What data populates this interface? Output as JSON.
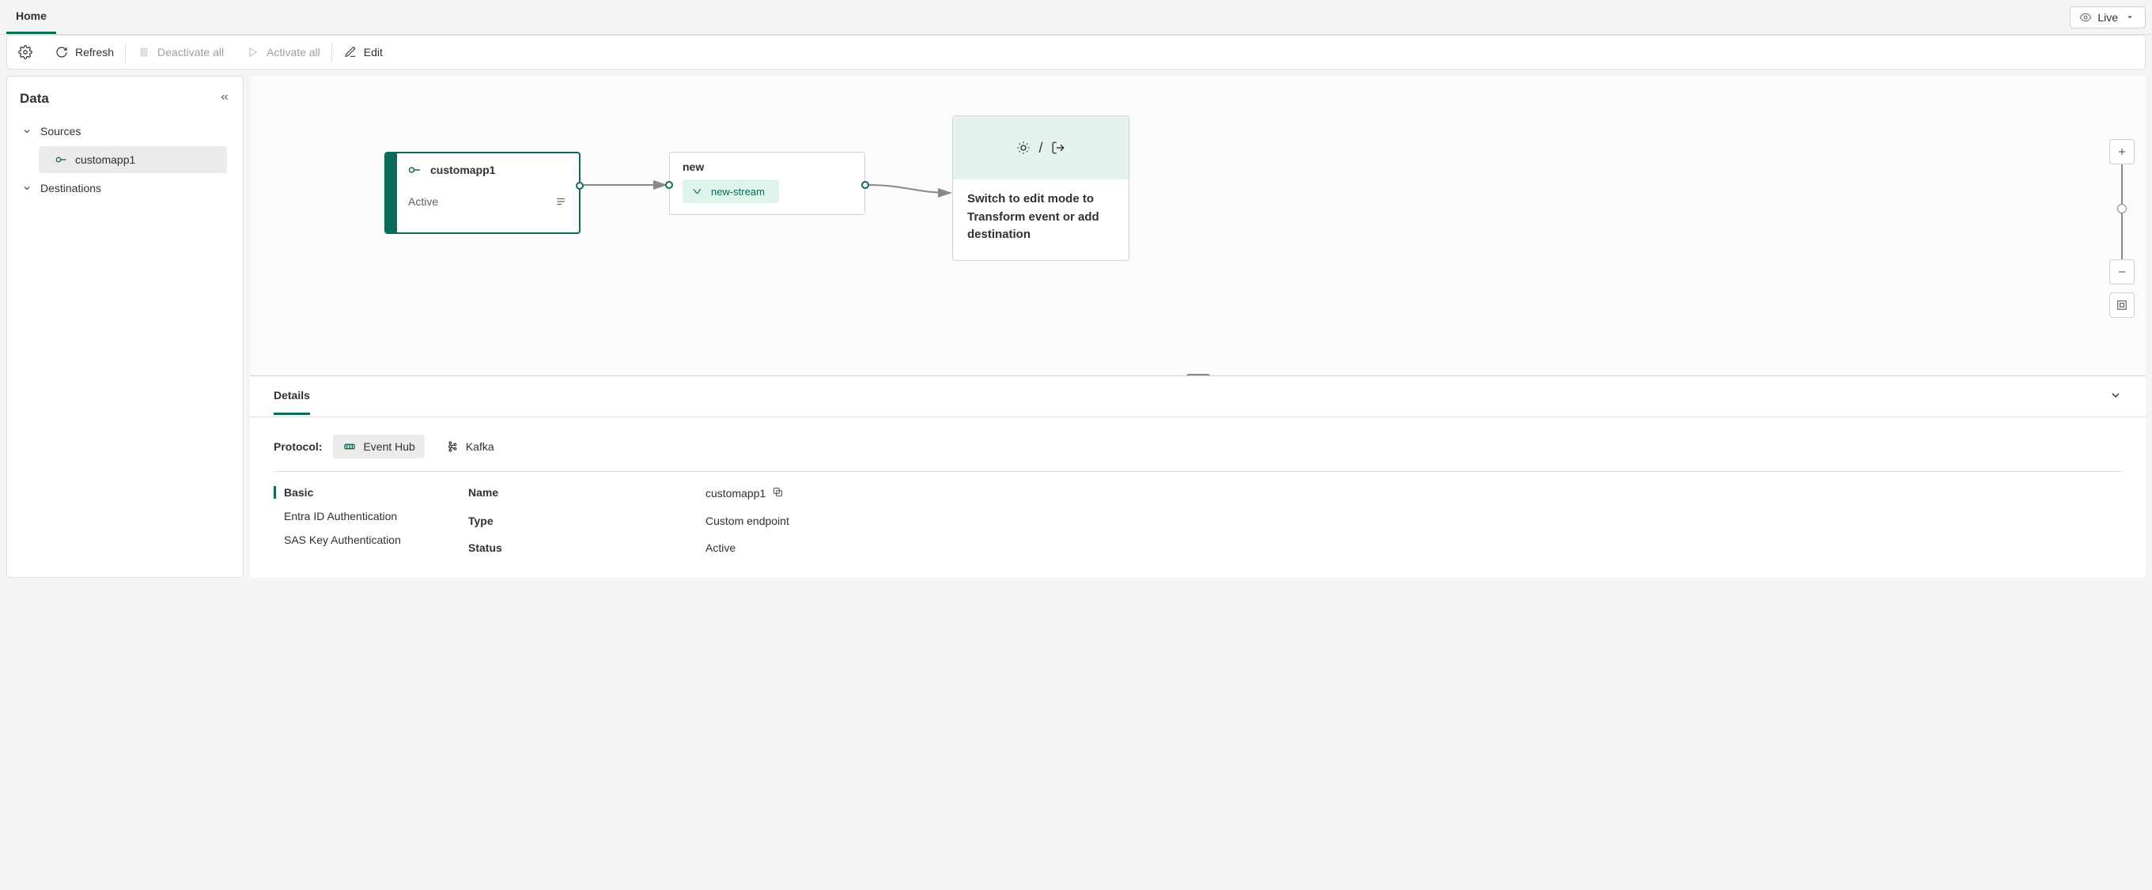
{
  "topbar": {
    "home": "Home",
    "live": "Live"
  },
  "toolbar": {
    "refresh": "Refresh",
    "deactivate": "Deactivate all",
    "activate": "Activate all",
    "edit": "Edit"
  },
  "side": {
    "title": "Data",
    "sources": "Sources",
    "destinations": "Destinations",
    "items": {
      "customapp": "customapp1"
    }
  },
  "canvas": {
    "source": {
      "name": "customapp1",
      "status": "Active"
    },
    "stream": {
      "title": "new",
      "chip": "new-stream"
    },
    "dest": {
      "hint": "Switch to edit mode to Transform event or add destination"
    }
  },
  "details": {
    "tab": "Details",
    "protocol_label": "Protocol:",
    "protocols": {
      "eventhub": "Event Hub",
      "kafka": "Kafka"
    },
    "side_tabs": {
      "basic": "Basic",
      "entra": "Entra ID Authentication",
      "sas": "SAS Key Authentication"
    },
    "fields": {
      "name_label": "Name",
      "name_value": "customapp1",
      "type_label": "Type",
      "type_value": "Custom endpoint",
      "status_label": "Status",
      "status_value": "Active"
    }
  }
}
